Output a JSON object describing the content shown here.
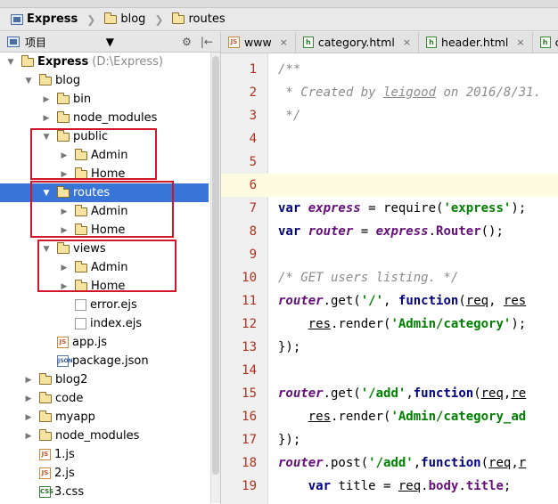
{
  "breadcrumb": {
    "items": [
      {
        "label": "Express"
      },
      {
        "label": "blog"
      },
      {
        "label": "routes"
      }
    ]
  },
  "project_pane": {
    "title": "项目",
    "tools": [
      "⚙",
      "|←"
    ]
  },
  "tree": [
    {
      "label": "Express",
      "hint": "(D:\\Express)",
      "type": "project",
      "arrow": "▼",
      "indent": 0,
      "selected": false
    },
    {
      "label": "blog",
      "type": "folder",
      "arrow": "▼",
      "indent": 1,
      "selected": false
    },
    {
      "label": "bin",
      "type": "folder",
      "arrow": "▶",
      "indent": 2,
      "selected": false
    },
    {
      "label": "node_modules",
      "type": "folder",
      "arrow": "▶",
      "indent": 2,
      "selected": false
    },
    {
      "label": "public",
      "type": "folder",
      "arrow": "▼",
      "indent": 2,
      "selected": false
    },
    {
      "label": "Admin",
      "type": "folder",
      "arrow": "▶",
      "indent": 3,
      "selected": false
    },
    {
      "label": "Home",
      "type": "folder",
      "arrow": "▶",
      "indent": 3,
      "selected": false
    },
    {
      "label": "routes",
      "type": "folder",
      "arrow": "▼",
      "indent": 2,
      "selected": true
    },
    {
      "label": "Admin",
      "type": "folder",
      "arrow": "▶",
      "indent": 3,
      "selected": false
    },
    {
      "label": "Home",
      "type": "folder",
      "arrow": "▶",
      "indent": 3,
      "selected": false
    },
    {
      "label": "views",
      "type": "folder",
      "arrow": "▼",
      "indent": 2,
      "selected": false
    },
    {
      "label": "Admin",
      "type": "folder",
      "arrow": "▶",
      "indent": 3,
      "selected": false
    },
    {
      "label": "Home",
      "type": "folder",
      "arrow": "▶",
      "indent": 3,
      "selected": false
    },
    {
      "label": "error.ejs",
      "type": "ejs",
      "arrow": "",
      "indent": 3,
      "selected": false
    },
    {
      "label": "index.ejs",
      "type": "ejs",
      "arrow": "",
      "indent": 3,
      "selected": false
    },
    {
      "label": "app.js",
      "type": "js",
      "arrow": "",
      "indent": 2,
      "selected": false
    },
    {
      "label": "package.json",
      "type": "json",
      "arrow": "",
      "indent": 2,
      "selected": false
    },
    {
      "label": "blog2",
      "type": "folder",
      "arrow": "▶",
      "indent": 1,
      "selected": false
    },
    {
      "label": "code",
      "type": "folder",
      "arrow": "▶",
      "indent": 1,
      "selected": false
    },
    {
      "label": "myapp",
      "type": "folder",
      "arrow": "▶",
      "indent": 1,
      "selected": false
    },
    {
      "label": "node_modules",
      "type": "folder",
      "arrow": "▶",
      "indent": 1,
      "selected": false
    },
    {
      "label": "1.js",
      "type": "js",
      "arrow": "",
      "indent": 1,
      "selected": false
    },
    {
      "label": "2.js",
      "type": "js",
      "arrow": "",
      "indent": 1,
      "selected": false
    },
    {
      "label": "3.css",
      "type": "css",
      "arrow": "",
      "indent": 1,
      "selected": false
    }
  ],
  "icons": {
    "js": "JS",
    "css": "CSS",
    "json": "JSON",
    "html": "h"
  },
  "tabs": [
    {
      "label": "www",
      "icon": "js",
      "active": false
    },
    {
      "label": "category.html",
      "icon": "html",
      "active": false
    },
    {
      "label": "header.html",
      "icon": "html",
      "active": false
    },
    {
      "label": "category",
      "icon": "html",
      "active": false
    }
  ],
  "tab_close": "×",
  "colors": {
    "selection": "#3875d7",
    "annotation_box": "#d3172b",
    "current_line": "#fffbe0"
  },
  "code_lines": [
    {
      "no": "1",
      "current": false,
      "parts": [
        [
          "c-comment",
          "/**"
        ]
      ]
    },
    {
      "no": "2",
      "current": false,
      "parts": [
        [
          "c-comment",
          " * Created by "
        ],
        [
          "c-comment c-und",
          "leigood"
        ],
        [
          "c-comment",
          " on 2016/8/31."
        ]
      ]
    },
    {
      "no": "3",
      "current": false,
      "parts": [
        [
          "c-comment",
          " */"
        ]
      ]
    },
    {
      "no": "4",
      "current": false,
      "parts": []
    },
    {
      "no": "5",
      "current": false,
      "parts": []
    },
    {
      "no": "6",
      "current": true,
      "parts": []
    },
    {
      "no": "7",
      "current": false,
      "parts": [
        [
          "c-kw",
          "var "
        ],
        [
          "c-var",
          "express"
        ],
        [
          "c-fn",
          " = require("
        ],
        [
          "c-str",
          "'express'"
        ],
        [
          "c-fn",
          ");"
        ]
      ]
    },
    {
      "no": "8",
      "current": false,
      "parts": [
        [
          "c-kw",
          "var "
        ],
        [
          "c-var",
          "router"
        ],
        [
          "c-fn",
          " = "
        ],
        [
          "c-var",
          "express"
        ],
        [
          "c-fn",
          "."
        ],
        [
          "c-purple",
          "Router"
        ],
        [
          "c-fn",
          "();"
        ]
      ]
    },
    {
      "no": "9",
      "current": false,
      "parts": []
    },
    {
      "no": "10",
      "current": false,
      "parts": [
        [
          "c-comment",
          "/* GET users listing. */"
        ]
      ]
    },
    {
      "no": "11",
      "current": false,
      "parts": [
        [
          "c-var",
          "router"
        ],
        [
          "c-fn",
          ".get("
        ],
        [
          "c-str",
          "'/'"
        ],
        [
          "c-fn",
          ", "
        ],
        [
          "c-kw",
          "function"
        ],
        [
          "c-fn",
          "("
        ],
        [
          "c-und",
          "req"
        ],
        [
          "c-fn",
          ", "
        ],
        [
          "c-und",
          "res"
        ]
      ]
    },
    {
      "no": "12",
      "current": false,
      "parts": [
        [
          "c-fn",
          "    "
        ],
        [
          "c-und",
          "res"
        ],
        [
          "c-fn",
          ".render("
        ],
        [
          "c-str",
          "'Admin/category'"
        ],
        [
          "c-fn",
          ");"
        ]
      ]
    },
    {
      "no": "13",
      "current": false,
      "parts": [
        [
          "c-fn",
          "});"
        ]
      ]
    },
    {
      "no": "14",
      "current": false,
      "parts": []
    },
    {
      "no": "15",
      "current": false,
      "parts": [
        [
          "c-var",
          "router"
        ],
        [
          "c-fn",
          ".get("
        ],
        [
          "c-str",
          "'/add'"
        ],
        [
          "c-fn",
          ","
        ],
        [
          "c-kw",
          "function"
        ],
        [
          "c-fn",
          "("
        ],
        [
          "c-und",
          "req"
        ],
        [
          "c-fn",
          ","
        ],
        [
          "c-und",
          "re"
        ]
      ]
    },
    {
      "no": "16",
      "current": false,
      "parts": [
        [
          "c-fn",
          "    "
        ],
        [
          "c-und",
          "res"
        ],
        [
          "c-fn",
          ".render("
        ],
        [
          "c-str",
          "'Admin/category_ad"
        ]
      ]
    },
    {
      "no": "17",
      "current": false,
      "parts": [
        [
          "c-fn",
          "});"
        ]
      ]
    },
    {
      "no": "18",
      "current": false,
      "parts": [
        [
          "c-var",
          "router"
        ],
        [
          "c-fn",
          ".post("
        ],
        [
          "c-str",
          "'/add'"
        ],
        [
          "c-fn",
          ","
        ],
        [
          "c-kw",
          "function"
        ],
        [
          "c-fn",
          "("
        ],
        [
          "c-und",
          "req"
        ],
        [
          "c-fn",
          ","
        ],
        [
          "c-und",
          "r"
        ]
      ]
    },
    {
      "no": "19",
      "current": false,
      "parts": [
        [
          "c-fn",
          "    "
        ],
        [
          "c-kw",
          "var "
        ],
        [
          "c-fn",
          "title = "
        ],
        [
          "c-und",
          "req"
        ],
        [
          "c-fn",
          "."
        ],
        [
          "c-prop",
          "body"
        ],
        [
          "c-fn",
          "."
        ],
        [
          "c-prop",
          "title"
        ],
        [
          "c-fn",
          ";"
        ]
      ]
    }
  ]
}
